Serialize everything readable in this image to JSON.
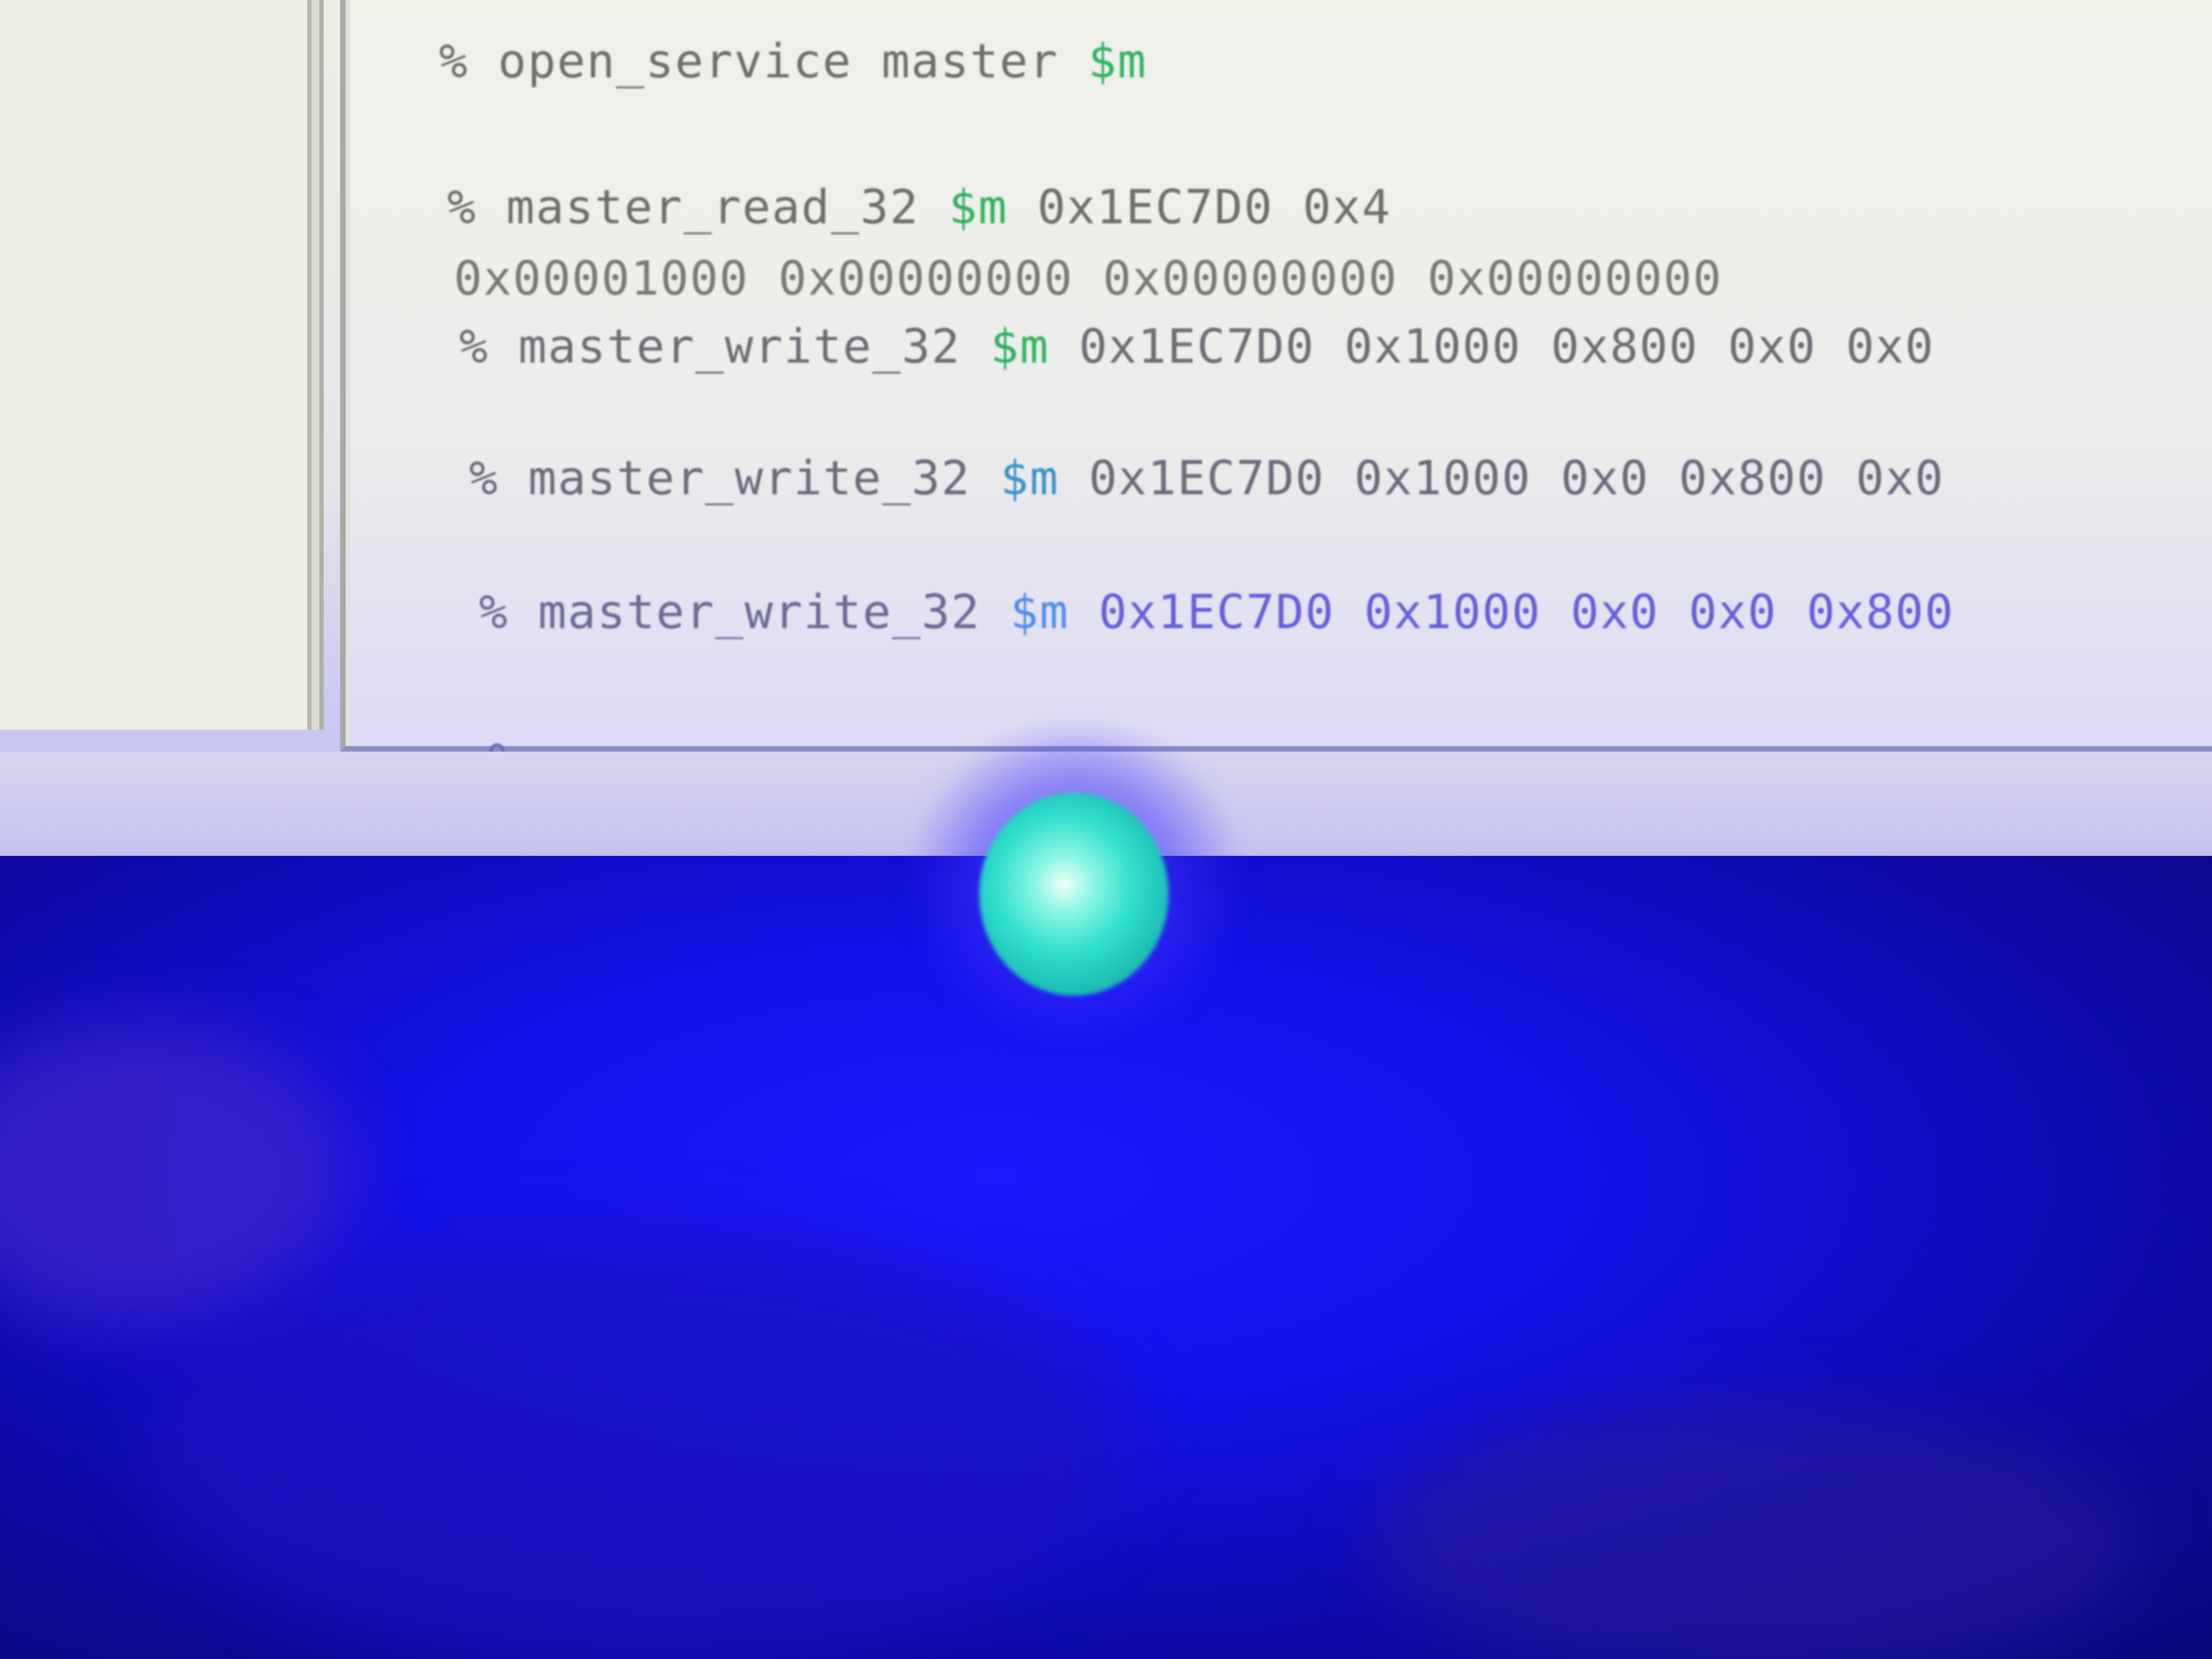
{
  "console": {
    "lines": [
      {
        "prompt": "%",
        "command": "open_service master",
        "var": "$m",
        "args": ""
      },
      {
        "prompt": "%",
        "command": "master_read_32",
        "var": "$m",
        "args": "0x1EC7D0 0x4"
      },
      {
        "output": "0x00001000 0x00000000 0x00000000 0x00000000"
      },
      {
        "prompt": "%",
        "command": "master_write_32",
        "var": "$m",
        "args": "0x1EC7D0 0x1000 0x800 0x0 0x0"
      },
      {
        "prompt": "%",
        "command": "master_write_32",
        "var": "$m",
        "args": "0x1EC7D0 0x1000 0x0 0x800 0x0"
      },
      {
        "prompt": "%",
        "command": "master_write_32",
        "var": "$m",
        "args": "0x1EC7D0 0x1000 0x0 0x0 0x800"
      },
      {
        "prompt": "%"
      }
    ]
  },
  "colors": {
    "text": "#6f6e6a",
    "variable": "#2fb35e",
    "led": "#2fe0cc",
    "desk": "#1410e6"
  }
}
